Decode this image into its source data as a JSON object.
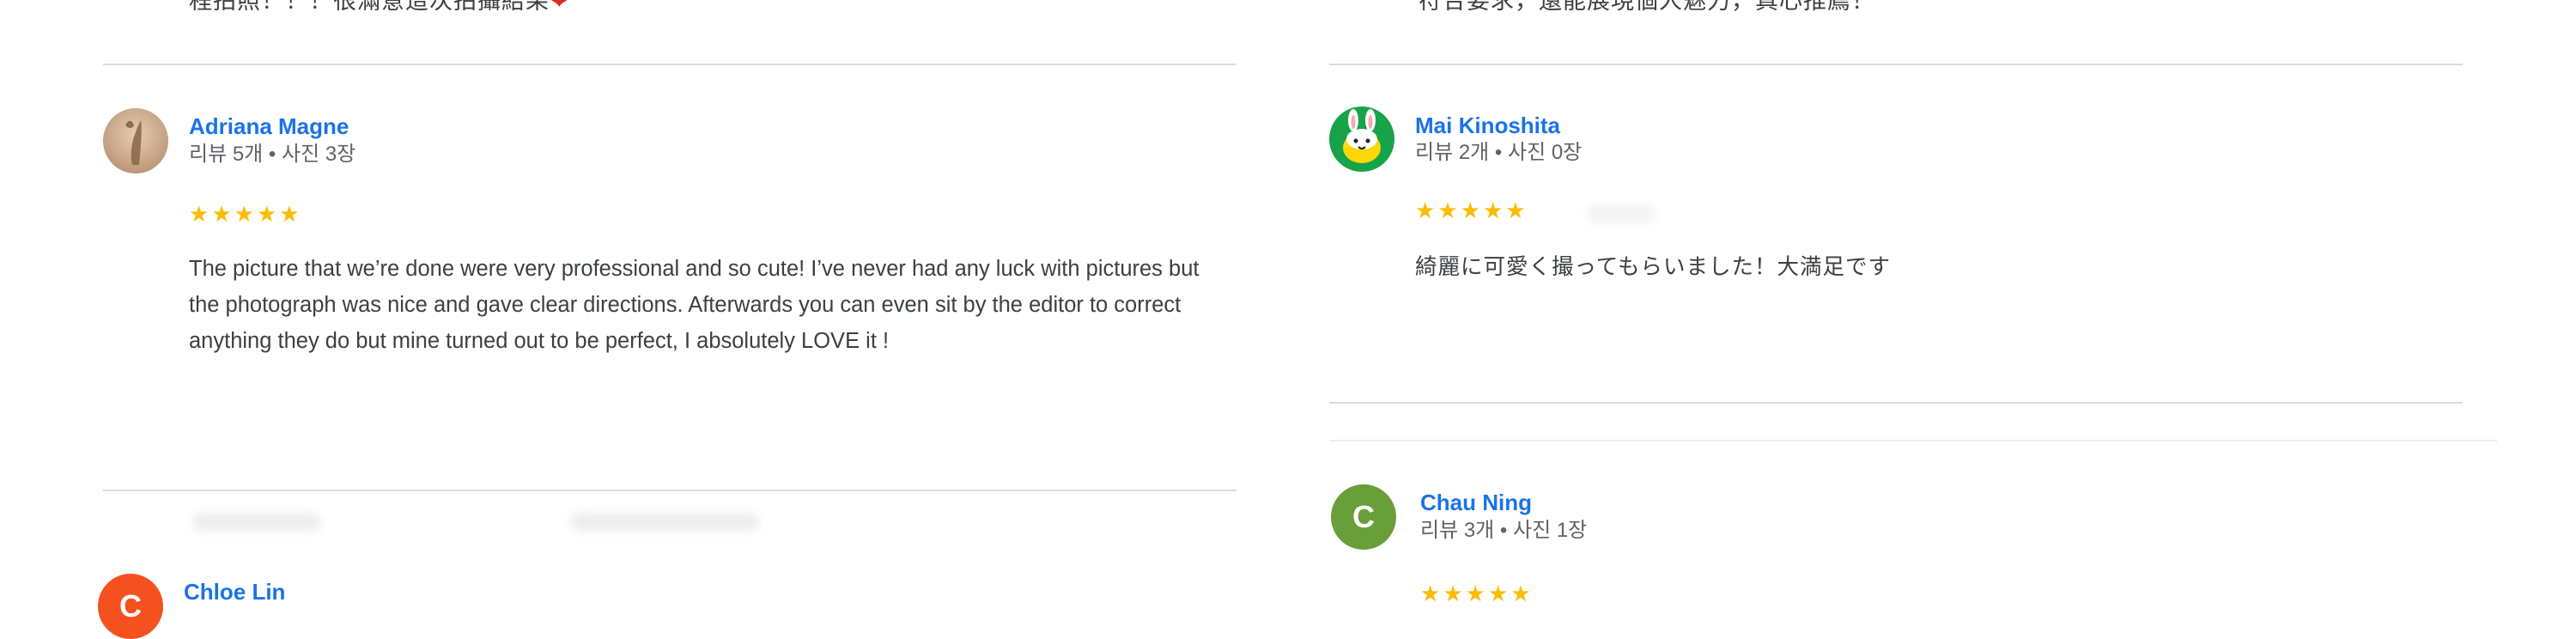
{
  "left_column": {
    "top_snippet": "程拍照！！！很滿意這次拍攝結果",
    "top_snippet_heart": "❤",
    "review_1": {
      "author": "Adriana Magne",
      "meta": "리뷰 5개 • 사진 3장",
      "rating": 5,
      "stars": [
        "★",
        "★",
        "★",
        "★",
        "★"
      ],
      "text": "The picture that we’re done were very professional and so cute! I’ve never had any luck with pictures but the photograph was nice and gave clear directions. Afterwards you can even sit by the editor to correct anything they do but mine turned out to be perfect, I absolutely LOVE it !"
    },
    "review_2": {
      "author": "Chloe Lin",
      "avatar_letter": "C"
    }
  },
  "right_column": {
    "top_snippet": "符合要求，還能展現個人魅力，真心推薦！",
    "review_1": {
      "author": "Mai Kinoshita",
      "meta": "리뷰 2개 • 사진 0장",
      "rating": 5,
      "stars": [
        "★",
        "★",
        "★",
        "★",
        "★"
      ],
      "text": "綺麗に可愛く撮ってもらいました！大満足です"
    },
    "review_2": {
      "author": "Chau Ning",
      "avatar_letter": "C",
      "meta": "리뷰 3개 • 사진 1장",
      "rating": 5,
      "stars": [
        "★",
        "★",
        "★",
        "★",
        "★"
      ]
    }
  },
  "colors": {
    "author_link": "#1a73e8",
    "star": "#fbbc04",
    "divider": "#dadce0",
    "avatar_chloe": "#f4511e",
    "avatar_chau": "#689f38",
    "avatar_mai_bg": "#16a34a"
  }
}
